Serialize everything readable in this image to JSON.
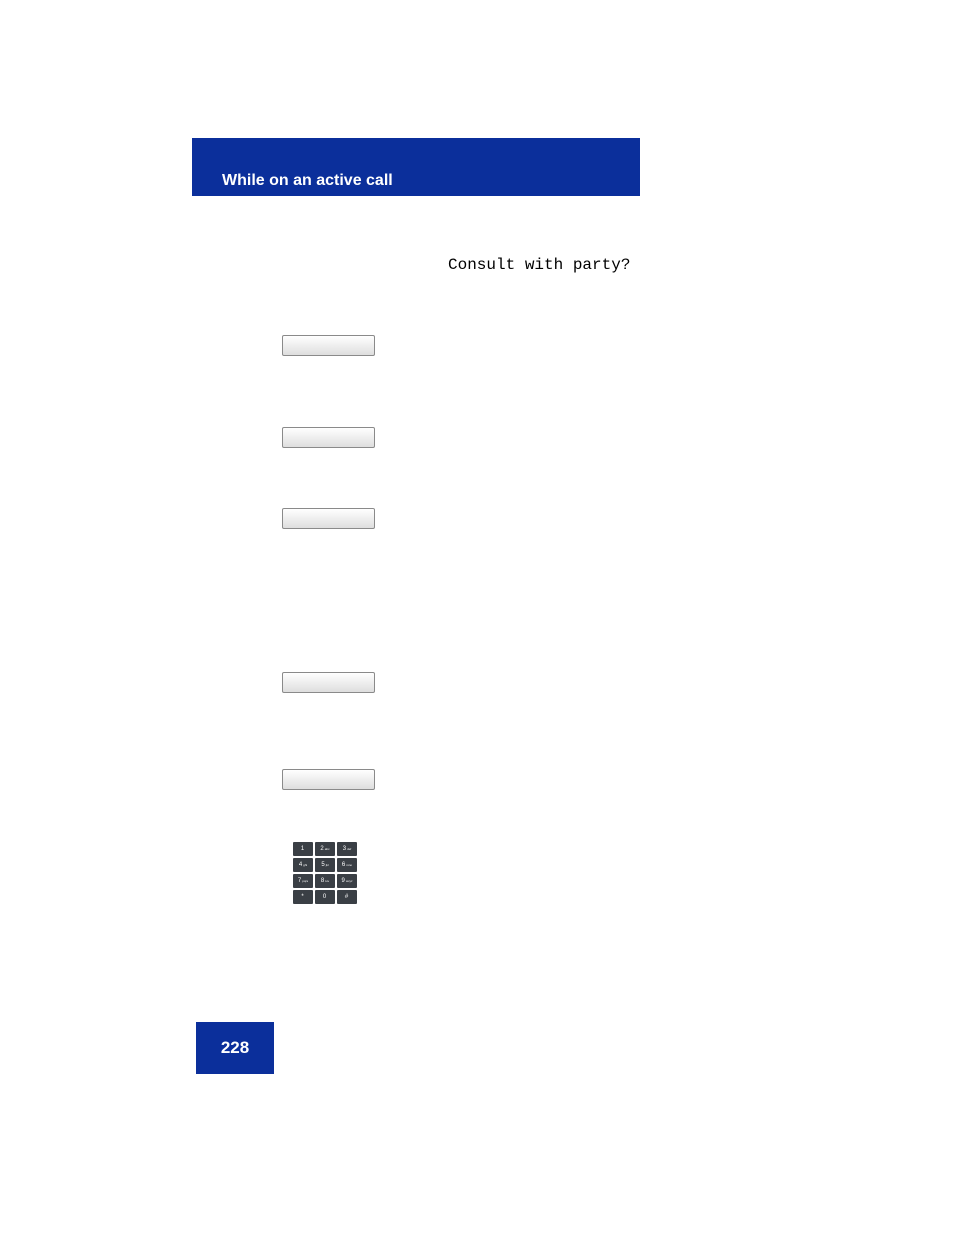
{
  "header": {
    "title": "While on an active call"
  },
  "body": {
    "consult_prompt": "Consult with party?"
  },
  "keypad": {
    "rows": [
      [
        {
          "num": "1",
          "sub": ""
        },
        {
          "num": "2",
          "sub": "abc"
        },
        {
          "num": "3",
          "sub": "def"
        }
      ],
      [
        {
          "num": "4",
          "sub": "ghi"
        },
        {
          "num": "5",
          "sub": "jkl"
        },
        {
          "num": "6",
          "sub": "mno"
        }
      ],
      [
        {
          "num": "7",
          "sub": "pqrs"
        },
        {
          "num": "8",
          "sub": "tuv"
        },
        {
          "num": "9",
          "sub": "wxyz"
        }
      ],
      [
        {
          "num": "*",
          "sub": ""
        },
        {
          "num": "0",
          "sub": ""
        },
        {
          "num": "#",
          "sub": ""
        }
      ]
    ]
  },
  "footer": {
    "page_number": "228"
  }
}
